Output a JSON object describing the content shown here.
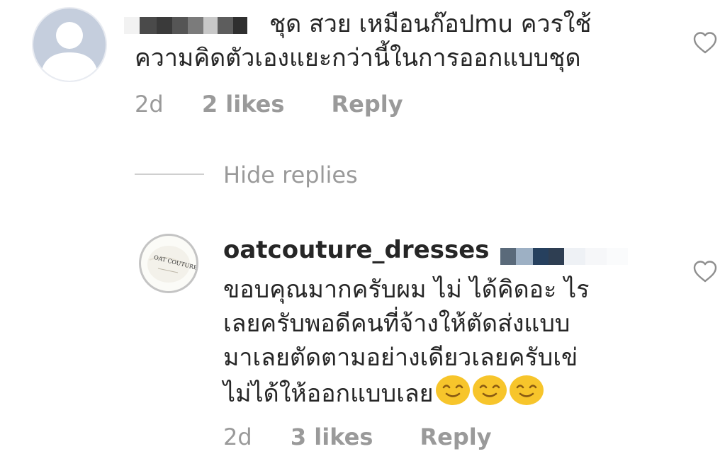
{
  "comment1": {
    "avatar_icon": "default-user-icon",
    "text_lines": [
      "ชุด สวย เหมือนก๊อปmu ควรใช้",
      "ความคิดตัวเองแยะกว่านี้ในการออกแบบชุด"
    ],
    "time": "2d",
    "likes": "2 likes",
    "reply_label": "Reply"
  },
  "hide_replies_label": "Hide replies",
  "comment2": {
    "username": "oatcouture_dresses",
    "avatar_text": "OAT COUTURE",
    "text_lines": [
      "ขอบคุณมากครับผม ไม่ ได้คิดอะ ไร",
      "เลยครับพอดีคนที่จ้างให้ตัดส่งแบบ",
      "มาเลยตัดตามอย่างเดียวเลยครับเข่",
      "ไม่ได้ให้ออกแบบเลย"
    ],
    "emoji": [
      "smiling-face-emoji",
      "smiling-face-emoji",
      "smiling-face-emoji"
    ],
    "time": "2d",
    "likes": "3 likes",
    "reply_label": "Reply"
  },
  "icons": {
    "heart": "heart-outline-icon"
  },
  "colors": {
    "text": "#262626",
    "muted": "#9a9a9a",
    "emoji": "#f7c52b"
  }
}
